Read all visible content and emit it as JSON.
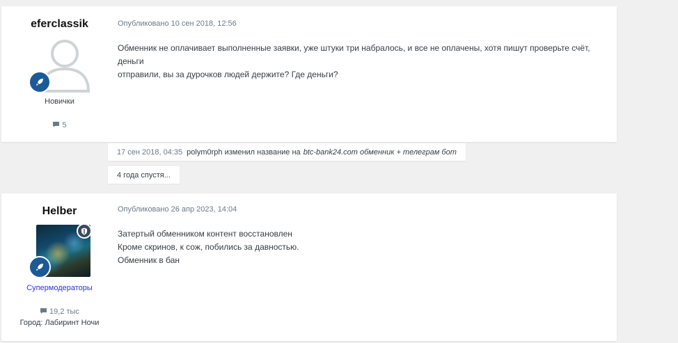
{
  "posts": [
    {
      "author": "eferclassik",
      "group": "Новички",
      "post_count": "5",
      "date": "Опубликовано 10 сен 2018, 12:56",
      "body": [
        "Обменник не оплачивает выполненные заявки, уже штуки три набралось, и все не оплачены, хотя пишут проверьте счёт, деньги",
        "отправили, вы за дурочков людей держите? Где деньги?"
      ]
    },
    {
      "author": "Helber",
      "group": "Супермодераторы",
      "post_count": "19,2 тыс",
      "location": "Город: Лабиринт Ночи",
      "date": "Опубликовано 26 апр 2023, 14:04",
      "body": [
        "Затертый обменником контент восстановлен",
        "Кроме скринов, к сож, побились за давностью.",
        "Обменник в бан"
      ]
    }
  ],
  "event": {
    "date": "17 сен 2018, 04:35",
    "user": "polym0rph",
    "action": "изменил название на",
    "new_title": "btc-bank24.com обменник + телеграм бот"
  },
  "time_gap": "4 года спустя...",
  "icons": {
    "rank": "rocket-icon",
    "moderator": "shield-icon",
    "posts": "comment-icon",
    "default_avatar": "user-silhouette-icon"
  },
  "colors": {
    "rank_badge": "#1c5a96",
    "moderator_group": "#2a35d6",
    "meta_text": "#6b7a87"
  }
}
